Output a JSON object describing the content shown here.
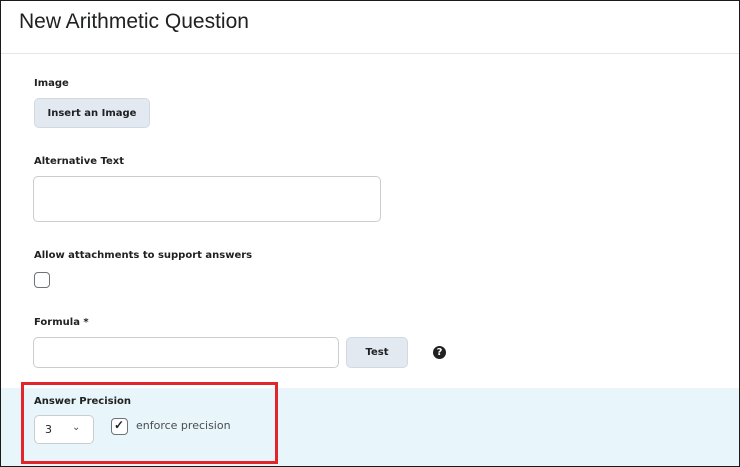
{
  "header": {
    "title": "New Arithmetic Question"
  },
  "image": {
    "label": "Image",
    "insert_button": "Insert an Image"
  },
  "alt_text": {
    "label": "Alternative Text",
    "value": ""
  },
  "attachments": {
    "label": "Allow attachments to support answers",
    "checked": false
  },
  "formula": {
    "label": "Formula *",
    "value": "",
    "test_button": "Test",
    "help_icon": "question-circle-icon"
  },
  "answer_precision": {
    "label": "Answer Precision",
    "selected": "3",
    "enforce_label": "enforce precision",
    "enforce_checked": true
  },
  "colors": {
    "band": "#e8f6fb",
    "highlight": "#e0262b",
    "button": "#e3e9f1"
  }
}
